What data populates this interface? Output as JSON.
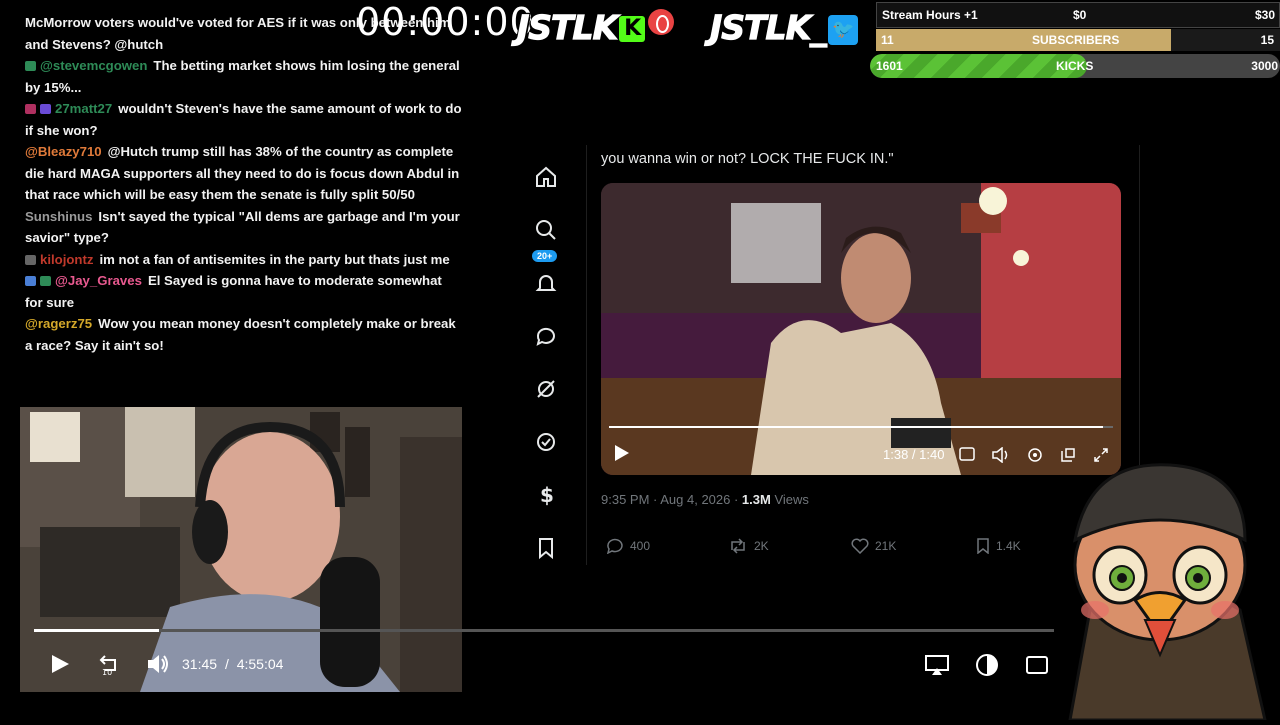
{
  "timer": "00:00:00",
  "logos": {
    "brand1": "JSTLK",
    "brand2": "JSTLK",
    "brand2_suffix": "_"
  },
  "goals": {
    "hours": {
      "label": "Stream Hours +1",
      "start": "$0",
      "end": "$30"
    },
    "subs": {
      "current": "11",
      "label": "SUBSCRIBERS",
      "goal": "15",
      "progress": 0.73
    },
    "kicks": {
      "current": "1601",
      "label": "KICKS",
      "goal": "3000",
      "progress": 0.53
    }
  },
  "chat": [
    {
      "user": "",
      "user_color": "#f2f2f2",
      "text": "McMorrow voters would've voted for AES if it was only between him and Stevens? @hutch",
      "badges": []
    },
    {
      "user": "@stevemcgowen",
      "user_color": "#2e8b57",
      "text": "The betting market shows him losing the general by 15%...",
      "badges": [
        "#2e8b57"
      ]
    },
    {
      "user": "27matt27",
      "user_color": "#2e8b57",
      "text": "wouldn't Steven's have the same amount of work to do if she won?",
      "badges": [
        "#b03060",
        "#6a4bd6"
      ]
    },
    {
      "user": "@Bleazy710",
      "user_color": "#e07a3a",
      "text": "@Hutch trump still has 38% of the country as complete die hard MAGA supporters all they need to do is focus down Abdul in that race which will be easy them the senate is fully split 50/50",
      "badges": []
    },
    {
      "user": "Sunshinus",
      "user_color": "#9a9a9a",
      "text": "Isn't sayed the typical \"All dems are garbage and I'm your savior\" type?",
      "badges": []
    },
    {
      "user": "kilojontz",
      "user_color": "#c0392b",
      "text": "im not a fan of antisemites in the party but thats just me",
      "badges": [
        "#666"
      ]
    },
    {
      "user": "@Jay_Graves",
      "user_color": "#e8598f",
      "text": "El Sayed is gonna have to moderate somewhat for sure",
      "badges": [
        "#4a7fd6",
        "#2e8b57"
      ]
    },
    {
      "user": "@ragerz75",
      "user_color": "#d4a82a",
      "text": "Wow you mean money doesn't completely make or break a race? Say it ain't so!",
      "badges": []
    }
  ],
  "tweet": {
    "text": "you wanna win or not? LOCK THE FUCK IN.\"",
    "video_time": "1:38 / 1:40",
    "video_progress": 0.98,
    "meta_time": "9:35 PM · Aug 4, 2026 · ",
    "views": "1.3M",
    "views_label": " Views",
    "replies": "400",
    "reposts": "2K",
    "likes": "21K",
    "bookmarks": "1.4K",
    "notif_badge": "20+"
  },
  "player": {
    "current": "31:45",
    "sep": "/",
    "duration": "4:55:04",
    "progress": 0.123
  },
  "icons": [
    "play-icon",
    "replay-10-icon",
    "volume-icon",
    "airplay-icon",
    "contrast-icon",
    "captions-icon",
    "home-icon",
    "search-icon",
    "bell-icon",
    "messages-icon",
    "grok-icon",
    "verified-icon",
    "money-icon",
    "bookmark-icon"
  ]
}
